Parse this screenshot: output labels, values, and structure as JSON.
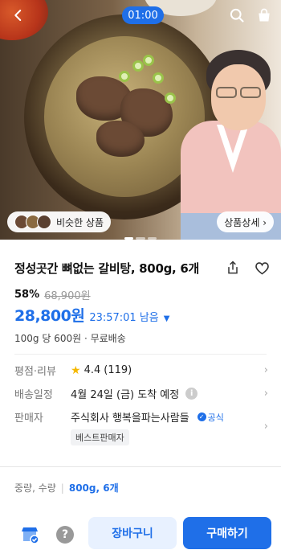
{
  "hero": {
    "timer_badge": "01:00",
    "similar_label": "비슷한 상품",
    "detail_label": "상품상세 ›"
  },
  "product": {
    "title": "정성곳간 뼈없는 갈비탕, 800g, 6개",
    "discount_rate": "58%",
    "original_price": "68,900원",
    "sale_price": "28,800원",
    "countdown": "23:57:01 남음",
    "unit_price": "100g 당 600원 · 무료배송"
  },
  "info": {
    "rating_label": "평점·리뷰",
    "rating_value": "4.4",
    "rating_count": "(119)",
    "delivery_label": "배송일정",
    "delivery_value": "4월 24일 (금) 도착 예정",
    "seller_label": "판매자",
    "seller_value": "주식회사 행복을파는사람들",
    "official_badge": "공식",
    "best_seller_badge": "베스트판매자"
  },
  "option": {
    "label": "중량, 수량",
    "value": "800g, 6개"
  },
  "bottom_bar": {
    "cart_label": "장바구니",
    "buy_label": "구매하기"
  },
  "colors": {
    "accent": "#1f6fe8",
    "star": "#f5b800"
  },
  "icons": {
    "back": "back-arrow-icon",
    "search": "search-icon",
    "cart": "shopping-bag-icon",
    "share": "share-icon",
    "wishlist": "heart-icon",
    "store": "store-icon",
    "help": "question-icon"
  }
}
